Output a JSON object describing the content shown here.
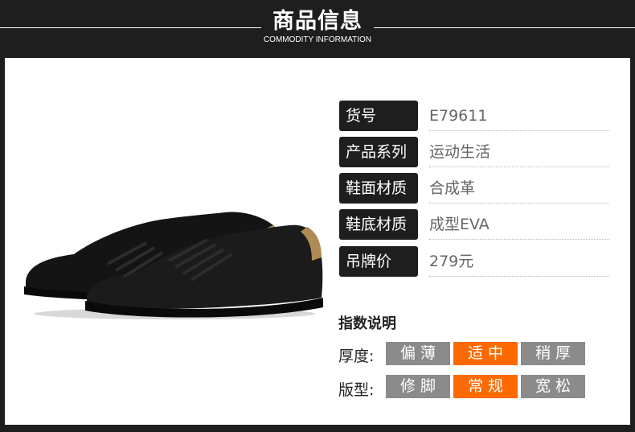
{
  "header": {
    "title": "商品信息",
    "subtitle": "COMMODITY INFORMATION"
  },
  "info": [
    {
      "label": "货号",
      "value": "E79611"
    },
    {
      "label": "产品系列",
      "value": "运动生活"
    },
    {
      "label": "鞋面材质",
      "value": "合成革"
    },
    {
      "label": "鞋底材质",
      "value": "成型EVA"
    },
    {
      "label": "吊牌价",
      "value": "279元"
    }
  ],
  "index": {
    "title": "指数说明",
    "thickness": {
      "label": "厚度:",
      "options": [
        "偏薄",
        "适中",
        "稍厚"
      ],
      "selected": "适中"
    },
    "fit": {
      "label": "版型:",
      "options": [
        "修脚",
        "常规",
        "宽松"
      ],
      "selected": "常规"
    }
  },
  "colors": {
    "dark": "#1e1e1e",
    "accent": "#ff6a00",
    "option_grey": "#8b8b8b",
    "shoe_tab": "#b08a55"
  }
}
